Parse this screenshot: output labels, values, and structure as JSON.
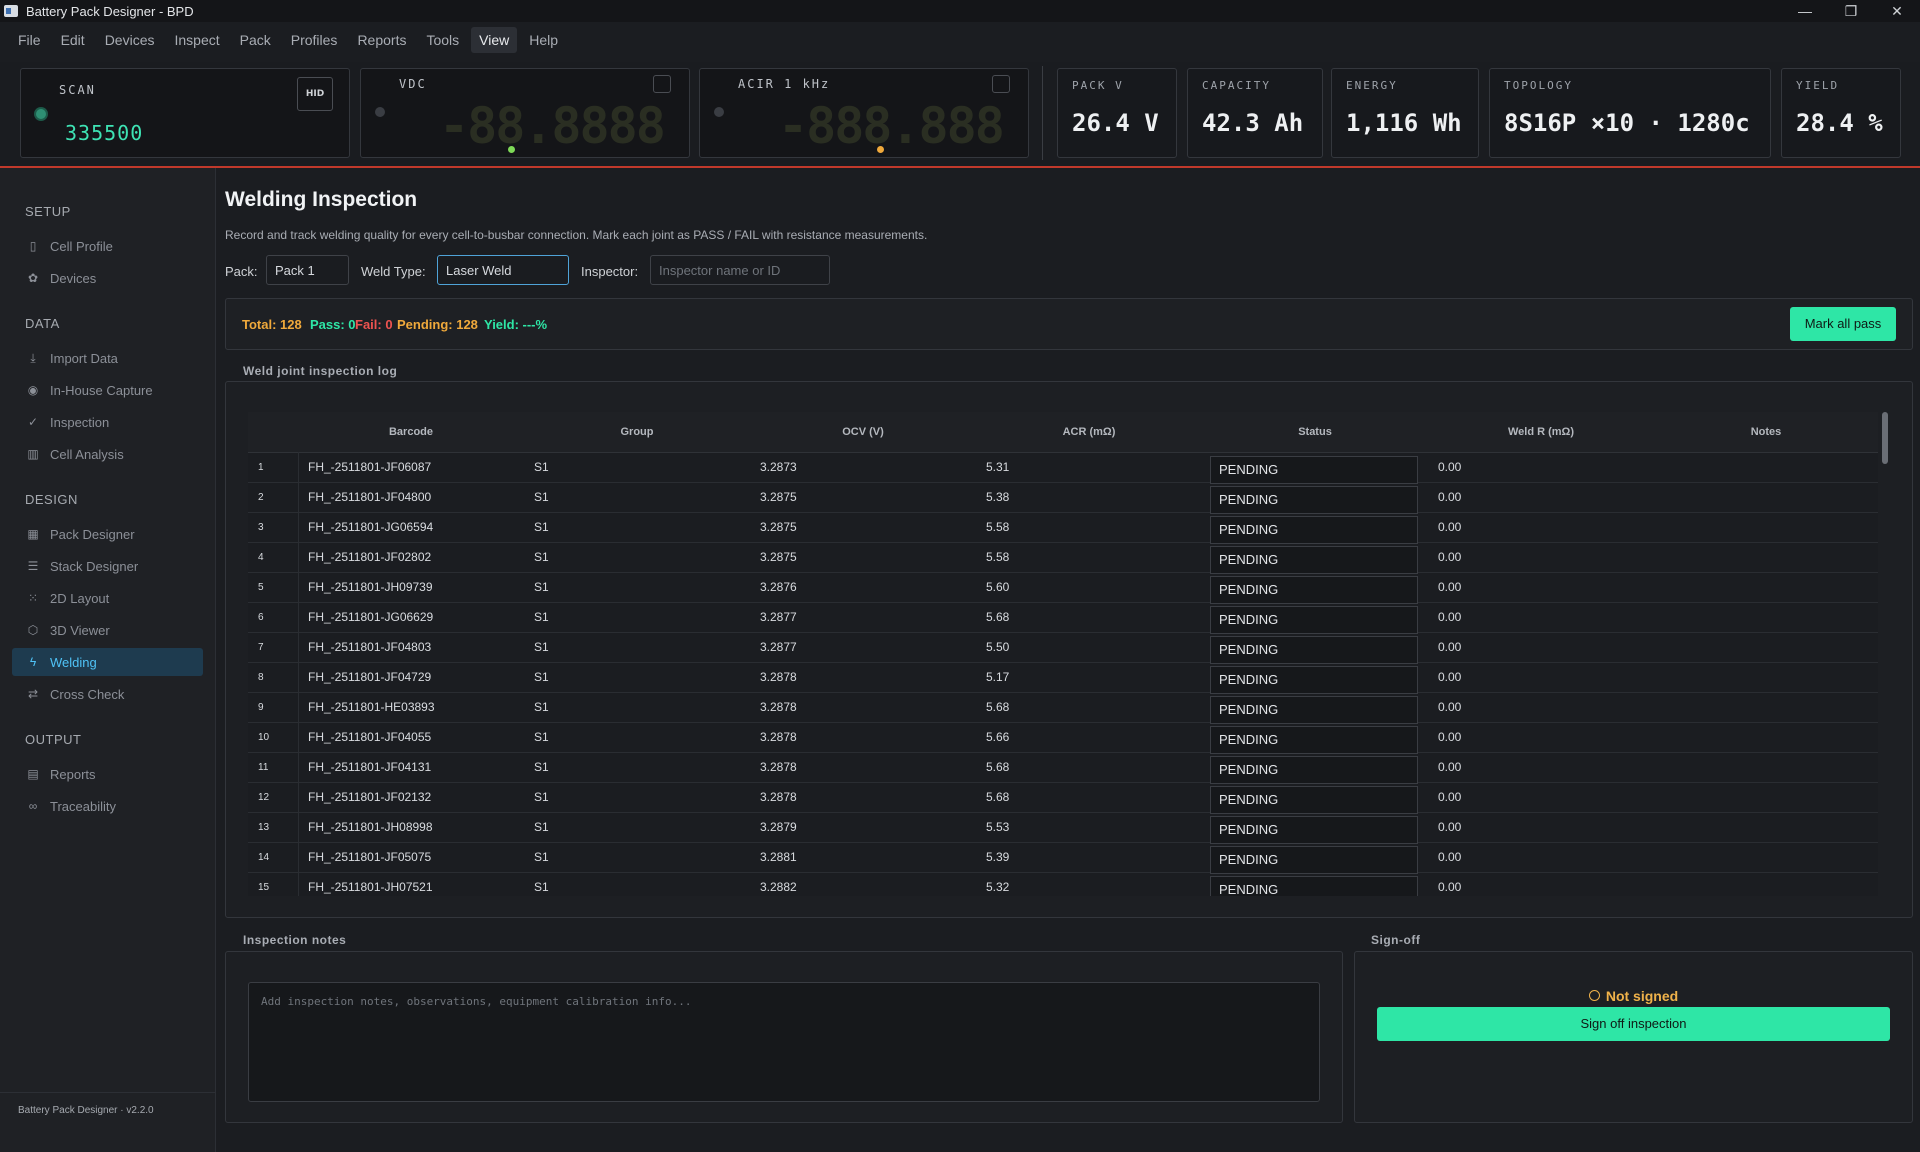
{
  "window": {
    "title": "Battery Pack Designer - BPD",
    "controls": [
      "—",
      "❐",
      "✕"
    ]
  },
  "menu": [
    "File",
    "Edit",
    "Devices",
    "Inspect",
    "Pack",
    "Profiles",
    "Reports",
    "Tools",
    "View",
    "Help"
  ],
  "menu_active": "View",
  "instruments": {
    "scan": {
      "label": "SCAN",
      "value": "335500",
      "hid": "HID"
    },
    "vdc": {
      "label": "VDC",
      "display": "-88.8888"
    },
    "acir": {
      "label": "ACIR  1 kHz",
      "display": "-888.888"
    }
  },
  "stats": [
    {
      "label": "PACK V",
      "value": "26.4 V"
    },
    {
      "label": "CAPACITY",
      "value": "42.3 Ah"
    },
    {
      "label": "ENERGY",
      "value": "1,116 Wh"
    },
    {
      "label": "TOPOLOGY",
      "value": "8S16P ×10 · 1280c"
    },
    {
      "label": "YIELD",
      "value": "28.4 %"
    }
  ],
  "sidebar": {
    "sections": [
      "SETUP",
      "DATA",
      "DESIGN",
      "OUTPUT"
    ],
    "items": [
      {
        "label": "Cell Profile",
        "icon": "battery-icon"
      },
      {
        "label": "Devices",
        "icon": "gear-icon"
      },
      {
        "label": "Import Data",
        "icon": "download-icon"
      },
      {
        "label": "In-House Capture",
        "icon": "target-icon"
      },
      {
        "label": "Inspection",
        "icon": "check-icon"
      },
      {
        "label": "Cell Analysis",
        "icon": "bar-chart-icon"
      },
      {
        "label": "Pack Designer",
        "icon": "grid-icon"
      },
      {
        "label": "Stack Designer",
        "icon": "layers-icon"
      },
      {
        "label": "2D Layout",
        "icon": "dots-grid-icon"
      },
      {
        "label": "3D Viewer",
        "icon": "cube-icon"
      },
      {
        "label": "Welding",
        "icon": "bolt-icon"
      },
      {
        "label": "Cross Check",
        "icon": "swap-icon"
      },
      {
        "label": "Reports",
        "icon": "document-icon"
      },
      {
        "label": "Traceability",
        "icon": "link-icon"
      }
    ],
    "active": "Welding",
    "footer": "Battery Pack Designer · v2.2.0"
  },
  "page": {
    "title": "Welding Inspection",
    "description": "Record and track welding quality for every cell-to-busbar connection. Mark each joint as PASS / FAIL with resistance measurements.",
    "pack_label": "Pack:",
    "pack_value": "Pack 1",
    "weld_type_label": "Weld Type:",
    "weld_type_value": "Laser Weld",
    "inspector_label": "Inspector:",
    "inspector_placeholder": "Inspector name or ID"
  },
  "summary": {
    "total": "Total: 128",
    "pass": "Pass: 0",
    "fail": "Fail: 0",
    "pending": "Pending: 128",
    "yield": "Yield: ---%",
    "mark_all_pass": "Mark all pass",
    "colors": {
      "total": "#f0a93b",
      "pass": "#2ee6a6",
      "fail": "#ef5350",
      "pending": "#f0a93b",
      "yield": "#2ee6a6"
    }
  },
  "table": {
    "title": "Weld joint inspection log",
    "columns": [
      "Barcode",
      "Group",
      "OCV (V)",
      "ACR (mΩ)",
      "Status",
      "Weld R (mΩ)",
      "Notes"
    ],
    "rows": [
      {
        "num": "1",
        "barcode": "FH_-2511801-JF06087",
        "group": "S1",
        "ocv": "3.2873",
        "acr": "5.31",
        "status": "PENDING",
        "weld_r": "0.00",
        "notes": ""
      },
      {
        "num": "2",
        "barcode": "FH_-2511801-JF04800",
        "group": "S1",
        "ocv": "3.2875",
        "acr": "5.38",
        "status": "PENDING",
        "weld_r": "0.00",
        "notes": ""
      },
      {
        "num": "3",
        "barcode": "FH_-2511801-JG06594",
        "group": "S1",
        "ocv": "3.2875",
        "acr": "5.58",
        "status": "PENDING",
        "weld_r": "0.00",
        "notes": ""
      },
      {
        "num": "4",
        "barcode": "FH_-2511801-JF02802",
        "group": "S1",
        "ocv": "3.2875",
        "acr": "5.58",
        "status": "PENDING",
        "weld_r": "0.00",
        "notes": ""
      },
      {
        "num": "5",
        "barcode": "FH_-2511801-JH09739",
        "group": "S1",
        "ocv": "3.2876",
        "acr": "5.60",
        "status": "PENDING",
        "weld_r": "0.00",
        "notes": ""
      },
      {
        "num": "6",
        "barcode": "FH_-2511801-JG06629",
        "group": "S1",
        "ocv": "3.2877",
        "acr": "5.68",
        "status": "PENDING",
        "weld_r": "0.00",
        "notes": ""
      },
      {
        "num": "7",
        "barcode": "FH_-2511801-JF04803",
        "group": "S1",
        "ocv": "3.2877",
        "acr": "5.50",
        "status": "PENDING",
        "weld_r": "0.00",
        "notes": ""
      },
      {
        "num": "8",
        "barcode": "FH_-2511801-JF04729",
        "group": "S1",
        "ocv": "3.2878",
        "acr": "5.17",
        "status": "PENDING",
        "weld_r": "0.00",
        "notes": ""
      },
      {
        "num": "9",
        "barcode": "FH_-2511801-HE03893",
        "group": "S1",
        "ocv": "3.2878",
        "acr": "5.68",
        "status": "PENDING",
        "weld_r": "0.00",
        "notes": ""
      },
      {
        "num": "10",
        "barcode": "FH_-2511801-JF04055",
        "group": "S1",
        "ocv": "3.2878",
        "acr": "5.66",
        "status": "PENDING",
        "weld_r": "0.00",
        "notes": ""
      },
      {
        "num": "11",
        "barcode": "FH_-2511801-JF04131",
        "group": "S1",
        "ocv": "3.2878",
        "acr": "5.68",
        "status": "PENDING",
        "weld_r": "0.00",
        "notes": ""
      },
      {
        "num": "12",
        "barcode": "FH_-2511801-JF02132",
        "group": "S1",
        "ocv": "3.2878",
        "acr": "5.68",
        "status": "PENDING",
        "weld_r": "0.00",
        "notes": ""
      },
      {
        "num": "13",
        "barcode": "FH_-2511801-JH08998",
        "group": "S1",
        "ocv": "3.2879",
        "acr": "5.53",
        "status": "PENDING",
        "weld_r": "0.00",
        "notes": ""
      },
      {
        "num": "14",
        "barcode": "FH_-2511801-JF05075",
        "group": "S1",
        "ocv": "3.2881",
        "acr": "5.39",
        "status": "PENDING",
        "weld_r": "0.00",
        "notes": ""
      },
      {
        "num": "15",
        "barcode": "FH_-2511801-JH07521",
        "group": "S1",
        "ocv": "3.2882",
        "acr": "5.32",
        "status": "PENDING",
        "weld_r": "0.00",
        "notes": ""
      }
    ]
  },
  "notes": {
    "title": "Inspection notes",
    "placeholder": "Add inspection notes, observations, equipment calibration info..."
  },
  "signoff": {
    "title": "Sign-off",
    "status": "Not signed",
    "button": "Sign off inspection"
  }
}
